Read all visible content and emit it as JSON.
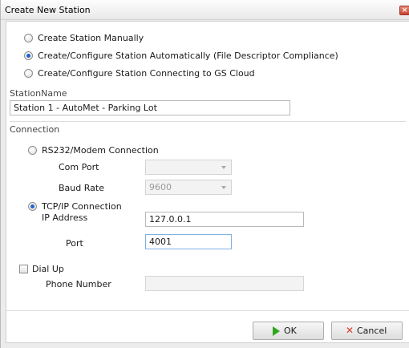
{
  "window": {
    "title": "Create New Station",
    "close_glyph": "×"
  },
  "creation_mode": {
    "options": [
      {
        "label": "Create Station Manually",
        "selected": false
      },
      {
        "label": "Create/Configure Station Automatically (File Descriptor Compliance)",
        "selected": true
      },
      {
        "label": "Create/Configure Station Connecting to GS Cloud",
        "selected": false
      }
    ]
  },
  "station_name": {
    "label": "StationName",
    "value": "Station 1 - AutoMet - Parking Lot"
  },
  "connection": {
    "section_label": "Connection",
    "rs232": {
      "label": "RS232/Modem Connection",
      "selected": false,
      "com_port_label": "Com Port",
      "com_port_value": "",
      "baud_rate_label": "Baud Rate",
      "baud_rate_value": "9600"
    },
    "tcpip": {
      "label": "TCP/IP Connection",
      "selected": true,
      "ip_label": "IP Address",
      "ip_value": "127.0.0.1",
      "port_label": "Port",
      "port_value": "4001"
    },
    "dialup": {
      "label": "Dial Up",
      "checked": false,
      "phone_label": "Phone Number",
      "phone_value": ""
    }
  },
  "buttons": {
    "ok_label": "OK",
    "cancel_label": "Cancel",
    "cancel_glyph": "✕"
  },
  "colors": {
    "accent_blue": "#1f63c9",
    "ok_green": "#2ea51f",
    "cancel_red": "#d8392a",
    "close_red": "#c74431"
  }
}
